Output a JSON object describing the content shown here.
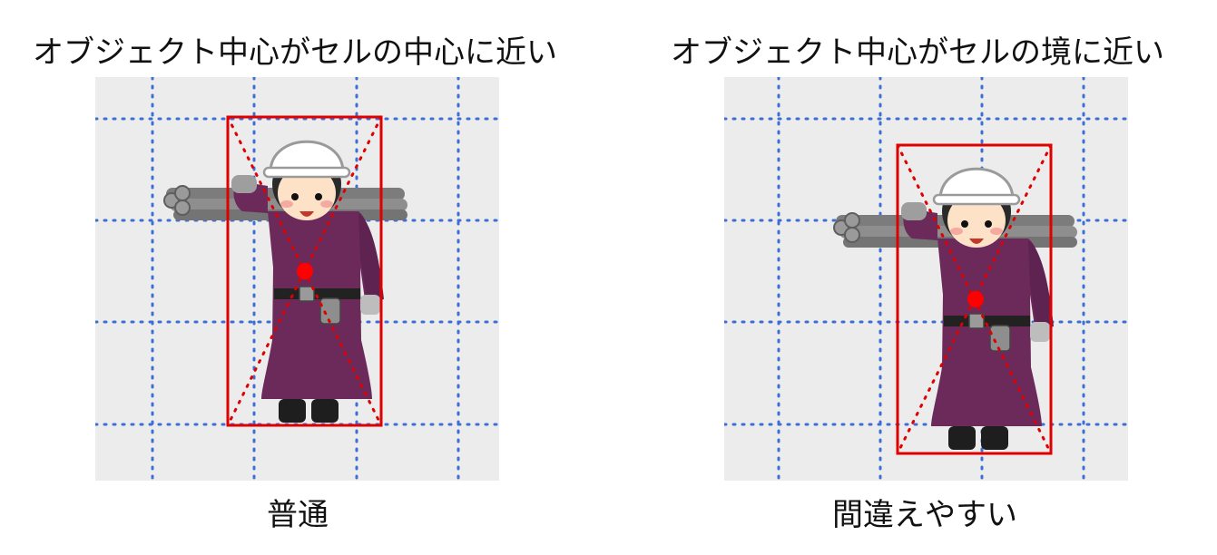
{
  "panels": [
    {
      "title": "オブジェクト中心がセルの中心に近い",
      "caption": "普通"
    },
    {
      "title": "オブジェクト中心がセルの境に近い",
      "caption": "間違えやすい"
    }
  ],
  "colors": {
    "background": "#ececec",
    "grid": "#3b6fd6",
    "bbox": "#e00000",
    "center": "#ff0000",
    "uniform": "#6b2a5a",
    "helmet": "#ffffff",
    "pipe": "#808080"
  },
  "icons": [
    "construction-worker-illustration",
    "pipe-bundle-icon"
  ]
}
